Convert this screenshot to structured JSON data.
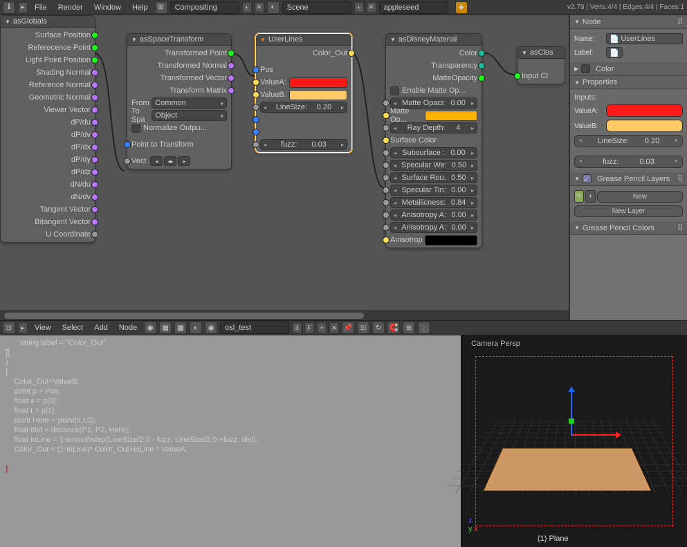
{
  "topbar": {
    "menus": [
      "File",
      "Render",
      "Window",
      "Help"
    ],
    "layout": "Compositing",
    "scene": "Scene",
    "renderer": "appleseed",
    "stats": "v2.79 | Verts:4/4 | Edges:4/4 | Faces:1"
  },
  "nodes": {
    "globals": {
      "title": "asGlobals",
      "outs": [
        "Surface Position",
        "Referecence Point",
        "Light Point Position",
        "Shading Normal",
        "Reference Normal",
        "Geometric Normal",
        "Viewer Vector",
        "dP/du",
        "dP/dv",
        "dP/dx",
        "dP/dy",
        "dP/dz",
        "dN/du",
        "dN/dv",
        "Tangent Vector",
        "Bitangent Vector",
        "U Coordinate"
      ]
    },
    "space": {
      "title": "asSpaceTransform",
      "outs": [
        "Transformed Point",
        "Transformed Normal",
        "Transformed Vector",
        "Transform Matrix"
      ],
      "from_lbl": "From",
      "from_val": "Common",
      "tosp_lbl": "To Spa",
      "tosp_val": "Object",
      "normalize": "Normalize Outpu...",
      "ptt": "Point to Transform",
      "vect": "Vect"
    },
    "userlines": {
      "title": "UserLines",
      "out": "Color_Out",
      "pos": "Pos",
      "valA": "ValueA:",
      "valB": "ValueB:",
      "linesize_lbl": "LineSize:",
      "linesize_val": "0.20",
      "fuzz_lbl": "fuzz:",
      "fuzz_val": "0.03"
    },
    "disney": {
      "title": "asDisneyMaterial",
      "outs": [
        "Color",
        "Transparency",
        "MatteOpacity"
      ],
      "enable_matte": "Enable Matte Op...",
      "matte_opaci": {
        "l": "Matte Opaci:",
        "v": "0.00"
      },
      "matte_op": "Matte Op...",
      "ray_depth": {
        "l": "Ray Depth:",
        "v": "4"
      },
      "surface_color": "Surface Color",
      "subsurface": {
        "l": "Subsurface :",
        "v": "0.00"
      },
      "spec_we": {
        "l": "Specular We:",
        "v": "0.50"
      },
      "surf_rou": {
        "l": "Surface Rou:",
        "v": "0.50"
      },
      "spec_tin": {
        "l": "Specular Tin:",
        "v": "0.00"
      },
      "metal": {
        "l": "Metallicness:",
        "v": "0.84"
      },
      "aniso_a": {
        "l": "Anisotropy A:",
        "v": "0.00"
      },
      "aniso_a2": {
        "l": "Anisotropy A:",
        "v": "0.00"
      },
      "anisotrop": "Anisotrop"
    },
    "closure": {
      "title": "asClos",
      "in": "Input Cl"
    }
  },
  "right": {
    "node_hdr": "Node",
    "name_lbl": "Name:",
    "name_val": "UserLines",
    "label_lbl": "Label:",
    "color_hdr": "Color",
    "props_hdr": "Properties",
    "inputs_lbl": "Inputs:",
    "valA": "ValueA:",
    "valB": "ValueB:",
    "linesize": {
      "l": "LineSize:",
      "v": "0.20"
    },
    "fuzz": {
      "l": "fuzz:",
      "v": "0.03"
    },
    "gp_layers": "Grease Pencil Layers",
    "new": "New",
    "new_layer": "New Layer",
    "gp_colors": "Grease Pencil Colors"
  },
  "bottom_header": {
    "menus": [
      "View",
      "Select",
      "Add",
      "Node"
    ],
    "script": "osl_test",
    "pin": "3",
    "f": "F"
  },
  "code": "       string label = \"Color_Out\"\n]]\n)\n{\n    Color_Out=ValueB;\n    point p = Pos;\n    float s = p[0];\n    float t = p[1];\n    point Here = point(s,t,0);\n    float dist = distance(P1, P2, Here);\n    float inLine = 1-smoothstep(LineSize/2.0 - fuzz, LineSize/2.0 +fuzz, dist);\n    Color_Out = (1-inLine)* Color_Out+inLine * ValueA;\n\n",
  "code_end": "}",
  "viewport": {
    "persp": "Camera Persp",
    "obj": "(1) Plane",
    "axes": {
      "x": "x",
      "y": "y",
      "z": "z"
    }
  }
}
